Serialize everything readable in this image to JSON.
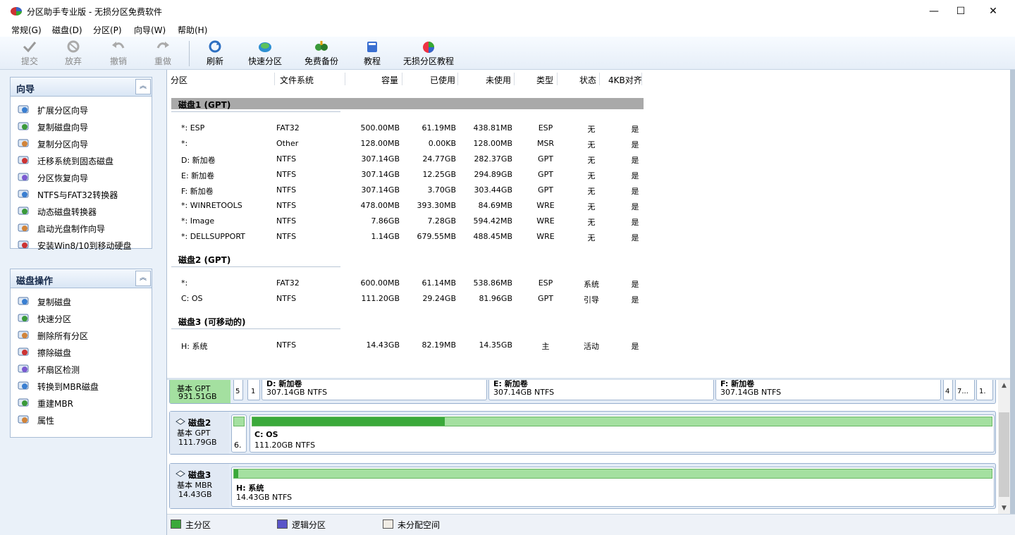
{
  "title": "分区助手专业版 - 无损分区免费软件",
  "window_controls": {
    "minimize": "—",
    "maximize": "☐",
    "close": "✕"
  },
  "menu": [
    "常规(G)",
    "磁盘(D)",
    "分区(P)",
    "向导(W)",
    "帮助(H)"
  ],
  "toolbar": {
    "commit": "提交",
    "discard": "放弃",
    "undo": "撤销",
    "redo": "重做",
    "refresh": "刷新",
    "quick_partition": "快速分区",
    "free_backup": "免费备份",
    "tutorial": "教程",
    "lossless_tutorial": "无损分区教程"
  },
  "wizard_panel": {
    "title": "向导",
    "items": [
      "扩展分区向导",
      "复制磁盘向导",
      "复制分区向导",
      "迁移系统到固态磁盘",
      "分区恢复向导",
      "NTFS与FAT32转换器",
      "动态磁盘转换器",
      "启动光盘制作向导",
      "安装Win8/10到移动硬盘"
    ]
  },
  "disk_ops_panel": {
    "title": "磁盘操作",
    "items": [
      "复制磁盘",
      "快速分区",
      "删除所有分区",
      "擦除磁盘",
      "坏扇区检测",
      "转换到MBR磁盘",
      "重建MBR",
      "属性"
    ]
  },
  "columns": [
    "分区",
    "文件系统",
    "容量",
    "已使用",
    "未使用",
    "类型",
    "状态",
    "4KB对齐"
  ],
  "disks": [
    {
      "header": "磁盘1 (GPT)",
      "rows": [
        [
          "*: ESP",
          "FAT32",
          "500.00MB",
          "61.19MB",
          "438.81MB",
          "ESP",
          "无",
          "是"
        ],
        [
          "*:",
          "Other",
          "128.00MB",
          "0.00KB",
          "128.00MB",
          "MSR",
          "无",
          "是"
        ],
        [
          "D: 新加卷",
          "NTFS",
          "307.14GB",
          "24.77GB",
          "282.37GB",
          "GPT",
          "无",
          "是"
        ],
        [
          "E: 新加卷",
          "NTFS",
          "307.14GB",
          "12.25GB",
          "294.89GB",
          "GPT",
          "无",
          "是"
        ],
        [
          "F: 新加卷",
          "NTFS",
          "307.14GB",
          "3.70GB",
          "303.44GB",
          "GPT",
          "无",
          "是"
        ],
        [
          "*: WINRETOOLS",
          "NTFS",
          "478.00MB",
          "393.30MB",
          "84.69MB",
          "WRE",
          "无",
          "是"
        ],
        [
          "*: Image",
          "NTFS",
          "7.86GB",
          "7.28GB",
          "594.42MB",
          "WRE",
          "无",
          "是"
        ],
        [
          "*: DELLSUPPORT",
          "NTFS",
          "1.14GB",
          "679.55MB",
          "488.45MB",
          "WRE",
          "无",
          "是"
        ]
      ]
    },
    {
      "header": "磁盘2 (GPT)",
      "rows": [
        [
          "*:",
          "FAT32",
          "600.00MB",
          "61.14MB",
          "538.86MB",
          "ESP",
          "系统",
          "是"
        ],
        [
          "C: OS",
          "NTFS",
          "111.20GB",
          "29.24GB",
          "81.96GB",
          "GPT",
          "引导",
          "是"
        ]
      ]
    },
    {
      "header": "磁盘3 (可移动的)",
      "rows": [
        [
          "H: 系统",
          "NTFS",
          "14.43GB",
          "82.19MB",
          "14.35GB",
          "主",
          "活动",
          "是"
        ]
      ]
    }
  ],
  "map": {
    "disk1": {
      "kind": "基本 GPT",
      "size": "931.51GB",
      "small1": "5",
      "small2": "1",
      "d_name": "D: 新加卷",
      "d_size": "307.14GB NTFS",
      "e_name": "E: 新加卷",
      "e_size": "307.14GB NTFS",
      "f_name": "F: 新加卷",
      "f_size": "307.14GB NTFS",
      "t1": "4",
      "t2": "7...",
      "t3": "1."
    },
    "disk2": {
      "name": "磁盘2",
      "kind": "基本 GPT",
      "size": "111.79GB",
      "small": "6.",
      "c_name": "C: OS",
      "c_size": "111.20GB NTFS",
      "c_used_fraction": 0.26
    },
    "disk3": {
      "name": "磁盘3",
      "kind": "基本 MBR",
      "size": "14.43GB",
      "h_name": "H: 系统",
      "h_size": "14.43GB NTFS",
      "h_used_fraction": 0.006
    }
  },
  "legend": {
    "primary": "主分区",
    "logical": "逻辑分区",
    "unallocated": "未分配空间"
  },
  "colors": {
    "primary": "#3aa93a",
    "logical": "#5a55c8",
    "unallocated": "#f0ece4"
  }
}
